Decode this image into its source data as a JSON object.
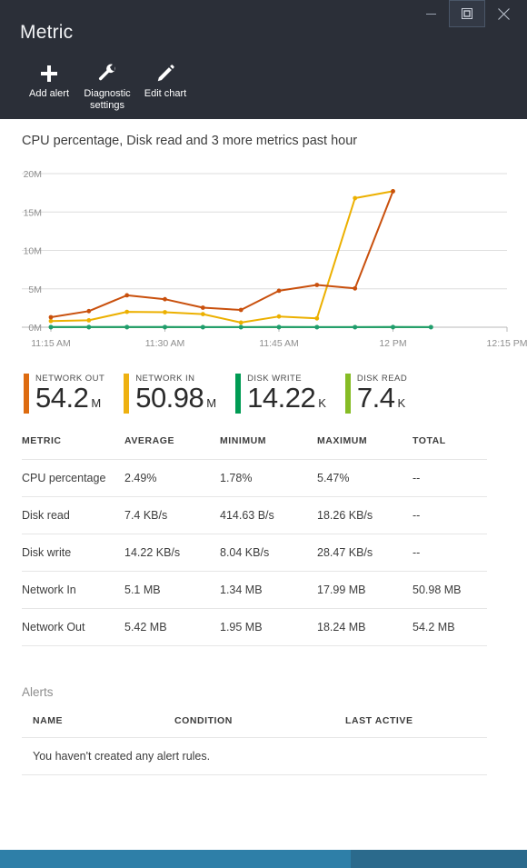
{
  "window": {
    "title": "Metric",
    "controls": [
      {
        "name": "minimize",
        "glyph": "minimize-icon"
      },
      {
        "name": "restore",
        "glyph": "restore-icon"
      },
      {
        "name": "close",
        "glyph": "close-icon"
      }
    ]
  },
  "toolbar": {
    "items": [
      {
        "label": "Add alert",
        "icon": "plus-icon"
      },
      {
        "label": "Diagnostic\nsettings",
        "icon": "wrench-icon"
      },
      {
        "label": "Edit chart",
        "icon": "pencil-icon"
      }
    ]
  },
  "chart_data": {
    "type": "line",
    "title": "CPU percentage, Disk read and 3 more metrics past hour",
    "xlabel": "",
    "ylabel": "",
    "ylim": [
      0,
      20000000
    ],
    "ytick_labels": [
      "0M",
      "5M",
      "10M",
      "15M",
      "20M"
    ],
    "ytick_values": [
      0,
      5000000,
      10000000,
      15000000,
      20000000
    ],
    "xtick_labels": [
      "11:15 AM",
      "11:30 AM",
      "11:45 AM",
      "12 PM",
      "12:15 PM"
    ],
    "xtick_values": [
      0,
      15,
      30,
      45,
      60
    ],
    "grid": true,
    "legend_position": "below-chart",
    "x": [
      0,
      5,
      10,
      15,
      20,
      25,
      30,
      35,
      40,
      45,
      50
    ],
    "series": [
      {
        "name": "Network Out",
        "color": "#c9500d",
        "values": [
          1300000,
          2100000,
          4150000,
          3650000,
          2550000,
          2250000,
          4750000,
          5500000,
          5050000,
          17700000,
          null
        ]
      },
      {
        "name": "Network In",
        "color": "#ecb000",
        "values": [
          800000,
          900000,
          2000000,
          1950000,
          1700000,
          600000,
          1400000,
          1150000,
          16800000,
          17700000,
          null
        ]
      },
      {
        "name": "Disk Write",
        "color": "#1f9e6e",
        "values": [
          20000,
          18000,
          22000,
          19000,
          16000,
          14000,
          21000,
          17000,
          15000,
          18000,
          14000
        ]
      },
      {
        "name": "Disk Read",
        "color": "#86bc25",
        "values": [
          9000,
          7000,
          8000,
          9000,
          7000,
          6000,
          9000,
          8000,
          7000,
          8000,
          7000
        ]
      },
      {
        "name": "CPU percentage",
        "color": "#0072c6",
        "values": [
          2000,
          2500,
          5470,
          2400,
          1780,
          2100,
          2600,
          2200,
          1900,
          2300,
          2100
        ]
      }
    ]
  },
  "legend_tiles": [
    {
      "name": "NETWORK OUT",
      "value": "54.2",
      "unit": "M",
      "color": "#dd6b10"
    },
    {
      "name": "NETWORK IN",
      "value": "50.98",
      "unit": "M",
      "color": "#eeb111"
    },
    {
      "name": "DISK WRITE",
      "value": "14.22",
      "unit": "K",
      "color": "#009b54"
    },
    {
      "name": "DISK READ",
      "value": "7.4",
      "unit": "K",
      "color": "#86bc25"
    }
  ],
  "metrics_table": {
    "headers": [
      "METRIC",
      "AVERAGE",
      "MINIMUM",
      "MAXIMUM",
      "TOTAL"
    ],
    "rows": [
      {
        "metric": "CPU percentage",
        "average": "2.49%",
        "minimum": "1.78%",
        "maximum": "5.47%",
        "total": "--"
      },
      {
        "metric": "Disk read",
        "average": "7.4 KB/s",
        "minimum": "414.63 B/s",
        "maximum": "18.26 KB/s",
        "total": "--"
      },
      {
        "metric": "Disk write",
        "average": "14.22 KB/s",
        "minimum": "8.04 KB/s",
        "maximum": "28.47 KB/s",
        "total": "--"
      },
      {
        "metric": "Network In",
        "average": "5.1 MB",
        "minimum": "1.34 MB",
        "maximum": "17.99 MB",
        "total": "50.98 MB"
      },
      {
        "metric": "Network Out",
        "average": "5.42 MB",
        "minimum": "1.95 MB",
        "maximum": "18.24 MB",
        "total": "54.2 MB"
      }
    ]
  },
  "alerts": {
    "title": "Alerts",
    "headers": [
      "NAME",
      "CONDITION",
      "LAST ACTIVE"
    ],
    "empty_message": "You haven't created any alert rules."
  },
  "colors": {
    "titlebar_bg": "#2b2f38",
    "taskbar_left": "#2e7fa8",
    "taskbar_right": "#2b6a8c"
  }
}
